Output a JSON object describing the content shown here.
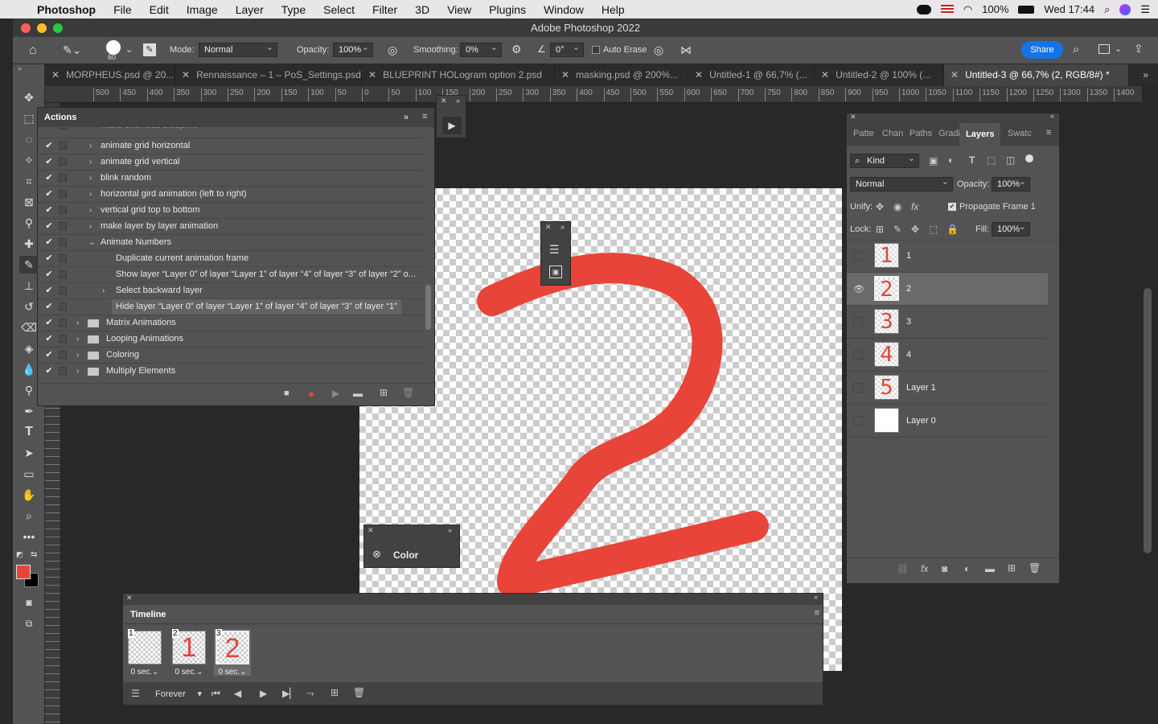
{
  "menubar": {
    "app": "Photoshop",
    "items": [
      "File",
      "Edit",
      "Image",
      "Layer",
      "Type",
      "Select",
      "Filter",
      "3D",
      "View",
      "Plugins",
      "Window",
      "Help"
    ],
    "battery": "100%",
    "clock": "Wed 17:44"
  },
  "window": {
    "title": "Adobe Photoshop 2022"
  },
  "options": {
    "brush_size": "60",
    "mode_label": "Mode:",
    "mode_value": "Normal",
    "opacity_label": "Opacity:",
    "opacity_value": "100%",
    "smoothing_label": "Smoothing:",
    "smoothing_value": "0%",
    "angle_value": "0°",
    "auto_erase": "Auto Erase",
    "share": "Share"
  },
  "tabs": [
    {
      "label": "MORPHEUS.psd @ 20..."
    },
    {
      "label": "Rennaissance – 1 – PoS_Settings.psd"
    },
    {
      "label": "BLUEPRINT HOLogram option 2.psd"
    },
    {
      "label": "masking.psd @ 200%..."
    },
    {
      "label": "Untitled-1 @ 66,7% (..."
    },
    {
      "label": "Untitled-2 @ 100% (..."
    },
    {
      "label": "Untitled-3 @ 66,7% (2, RGB/8#) *"
    }
  ],
  "ruler": {
    "labels": [
      "500",
      "450",
      "400",
      "350",
      "300",
      "250",
      "200",
      "150",
      "100",
      "50",
      "0",
      "50",
      "100",
      "150",
      "200",
      "250",
      "300",
      "350",
      "400",
      "450",
      "500",
      "550",
      "600",
      "650",
      "700",
      "750",
      "800",
      "850",
      "900",
      "950",
      "1000",
      "1050",
      "1100",
      "1150",
      "1200",
      "1250",
      "1300",
      "1350",
      "1400"
    ]
  },
  "actions_panel": {
    "title": "Actions",
    "partial_top": "make chemous blueprint",
    "rows": [
      {
        "label": "animate grid horizontal"
      },
      {
        "label": "animate grid vertical"
      },
      {
        "label": "blink random"
      },
      {
        "label": "horizontal gird animation (left to right)"
      },
      {
        "label": "vertical grid top to bottom"
      },
      {
        "label": "make layer by layer animation"
      },
      {
        "label": "Animate Numbers"
      },
      {
        "label": "Duplicate current animation frame"
      },
      {
        "label": "Show layer “Layer 0” of layer “Layer 1” of layer “4” of layer “3” of layer “2” o..."
      },
      {
        "label": "Select backward layer"
      },
      {
        "label": "Hide layer “Layer 0” of layer “Layer 1” of layer “4” of layer “3” of layer “1”"
      },
      {
        "label": "Matrix Animations"
      },
      {
        "label": "Looping Animations"
      },
      {
        "label": "Coloring"
      },
      {
        "label": "Multiply Elements"
      }
    ]
  },
  "color_panel": {
    "title": "Color"
  },
  "layers_panel": {
    "tabs": [
      "Patte",
      "Chan",
      "Paths",
      "Gradi",
      "Layers",
      "Swatc"
    ],
    "active_tab": "Layers",
    "kind_filter": "Kind",
    "blend_mode": "Normal",
    "opacity_label": "Opacity:",
    "opacity_value": "100%",
    "unify_label": "Unify:",
    "propagate": "Propagate Frame 1",
    "lock_label": "Lock:",
    "fill_label": "Fill:",
    "fill_value": "100%",
    "layers": [
      {
        "name": "1",
        "glyph": "1",
        "visible": false
      },
      {
        "name": "2",
        "glyph": "2",
        "visible": true
      },
      {
        "name": "3",
        "glyph": "3",
        "visible": false
      },
      {
        "name": "4",
        "glyph": "4",
        "visible": false
      },
      {
        "name": "Layer 1",
        "glyph": "5",
        "visible": false
      },
      {
        "name": "Layer 0",
        "glyph": "",
        "visible": false
      }
    ]
  },
  "timeline": {
    "title": "Timeline",
    "frames": [
      {
        "num": "1",
        "glyph": "",
        "duration": "0 sec.⌄"
      },
      {
        "num": "2",
        "glyph": "1",
        "duration": "0 sec.⌄"
      },
      {
        "num": "3",
        "glyph": "2",
        "duration": "0 sec.⌄"
      }
    ],
    "loop": "Forever"
  },
  "colors": {
    "stroke": "#e9443a",
    "accent": "#1473e6",
    "foreground": "#e9443a",
    "background": "#000000"
  }
}
